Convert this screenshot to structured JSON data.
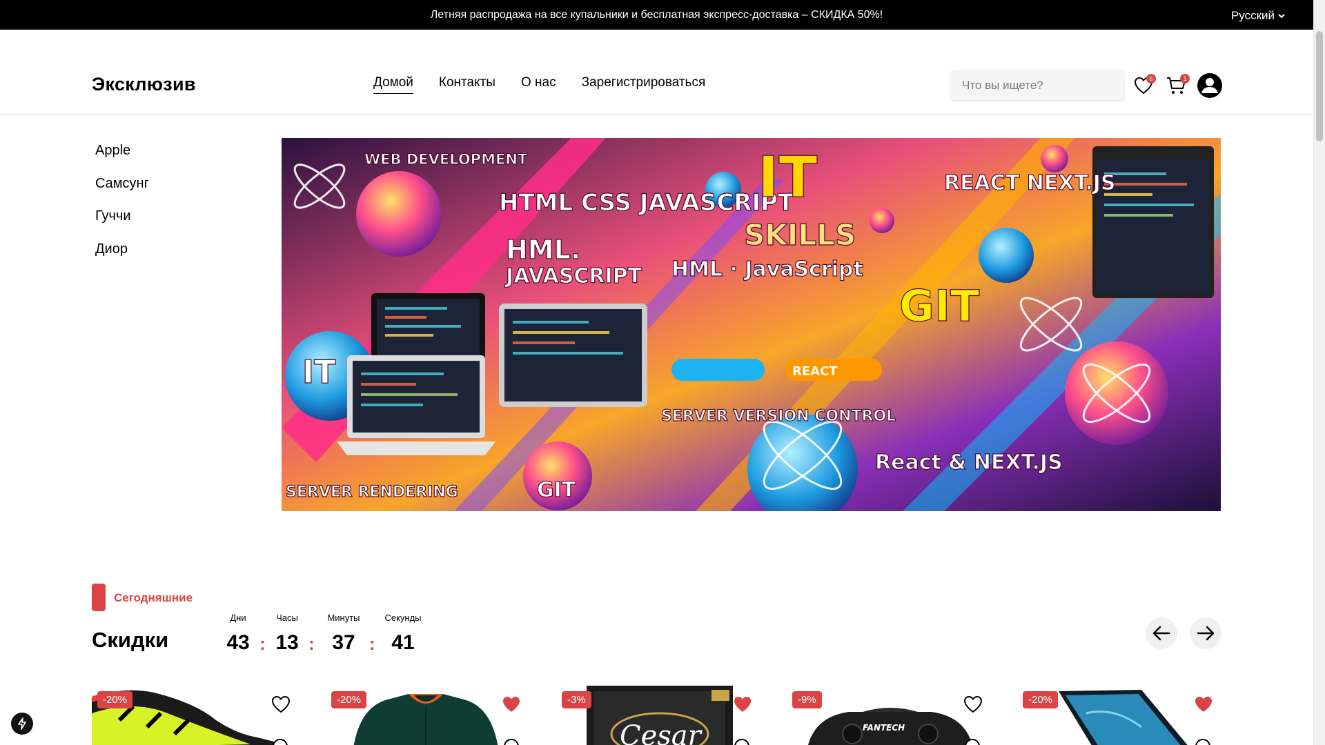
{
  "topbar": {
    "promo": "Летняя распродажа на все купальники и бесплатная экспресс-доставка – СКИДКА 50%!",
    "language": "Русский"
  },
  "header": {
    "logo": "Эксклюзив",
    "nav": [
      "Домой",
      "Контакты",
      "О нас",
      "Зарегистрироваться"
    ],
    "active_nav": "Домой",
    "search_placeholder": "Что вы ищете?",
    "wishlist_count": "6",
    "cart_count": "1"
  },
  "sidebar": {
    "items": [
      "Apple",
      "Самсунг",
      "Гуччи",
      "Диор"
    ]
  },
  "banner": {
    "texts": [
      "WEB DEVELOPMENT",
      "HTML CSS JAVASCRIPT",
      "IT",
      "SKILLS",
      "REACT NEXT.JS",
      "HML.",
      "JAVASCRIPT",
      "HML · JavaScript",
      "GIT",
      "IT",
      "SERVER VERSION CONTROL",
      "React & NEXT.JS",
      "SERVER RENDERING",
      "GIT",
      "REACT"
    ]
  },
  "section": {
    "label": "Сегодняшние",
    "title": "Скидки",
    "timer": {
      "days_label": "Дни",
      "days": "43",
      "hours_label": "Часы",
      "hours": "13",
      "minutes_label": "Минуты",
      "minutes": "37",
      "seconds_label": "Секунды",
      "seconds": "41",
      "separator": ":"
    }
  },
  "products": [
    {
      "discount": "-20%",
      "favorited": false,
      "image": "sneaker"
    },
    {
      "discount": "-20%",
      "favorited": true,
      "image": "jacket"
    },
    {
      "discount": "-3%",
      "favorited": true,
      "image": "cesar-pack",
      "brand": "Cesar"
    },
    {
      "discount": "-9%",
      "favorited": false,
      "image": "gamepad",
      "brand": "FANTECH"
    },
    {
      "discount": "-20%",
      "favorited": true,
      "image": "laptop"
    }
  ],
  "colors": {
    "accent": "#db4444",
    "topbar": "#000000",
    "search_bg": "#f5f5f5"
  }
}
